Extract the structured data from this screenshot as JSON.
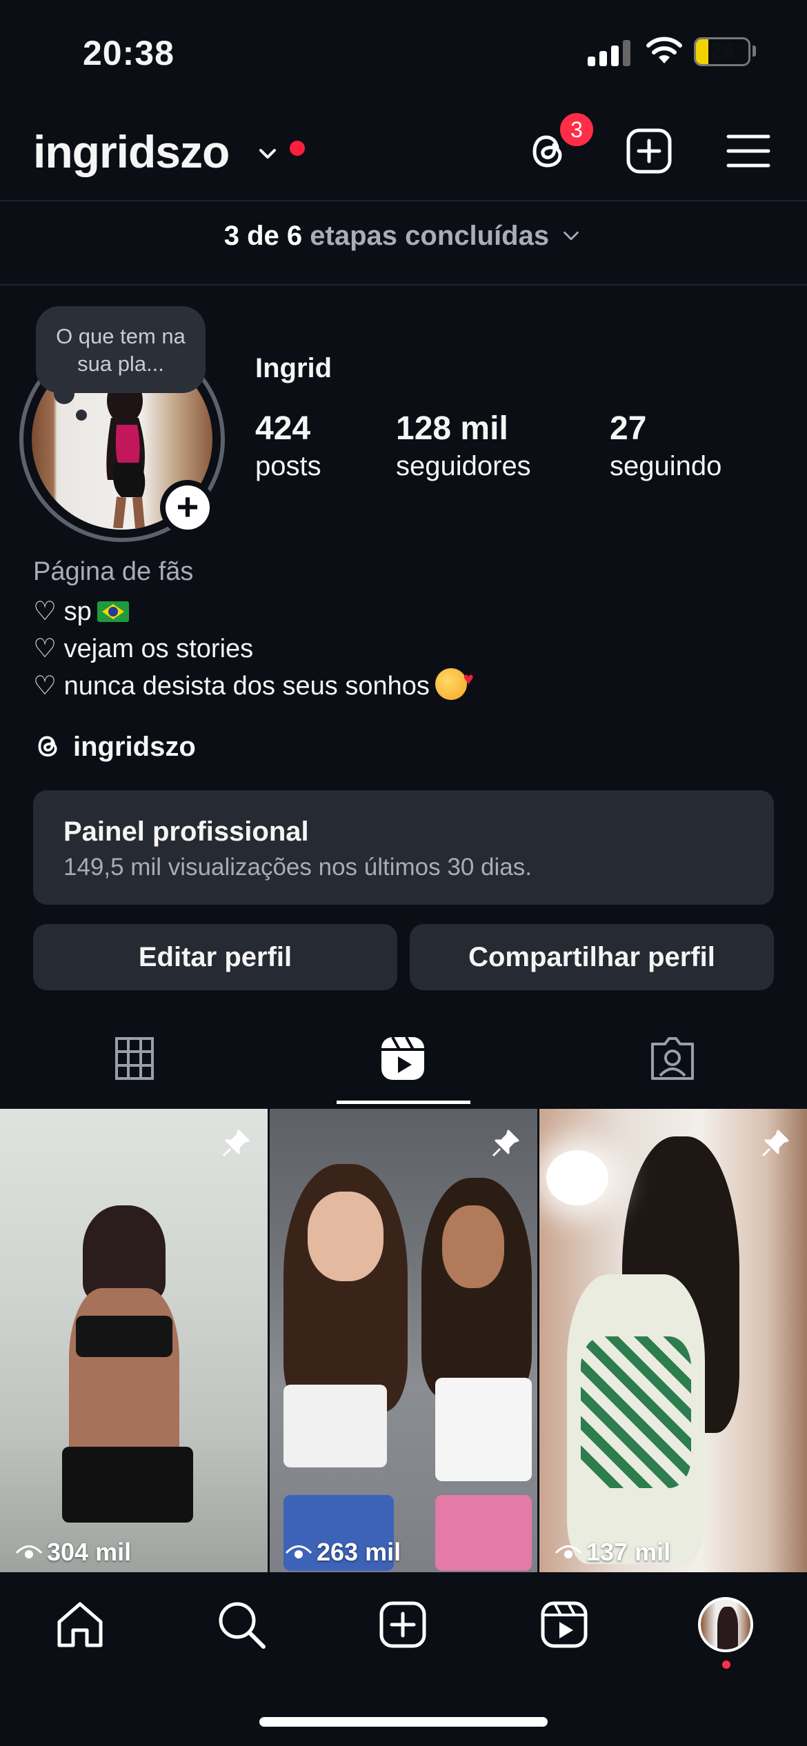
{
  "status_bar": {
    "time": "20:38",
    "battery": "24",
    "battery_level": 0.24
  },
  "header": {
    "username": "ingridszo",
    "threads_badge": "3",
    "icons": [
      "chevron-down-icon",
      "threads-icon",
      "create-icon",
      "menu-icon"
    ]
  },
  "steps": {
    "count": "3 de 6",
    "label": "etapas concluídas"
  },
  "profile": {
    "note": "O que tem na sua pla...",
    "name": "Ingrid",
    "stats": [
      {
        "value": "424",
        "label": "posts"
      },
      {
        "value": "128 mil",
        "label": "seguidores"
      },
      {
        "value": "27",
        "label": "seguindo"
      }
    ],
    "category": "Página de fãs",
    "bio": [
      "♡ sp",
      "♡ vejam os stories",
      "♡ nunca desista dos seus sonhos"
    ],
    "threads_handle": "ingridszo"
  },
  "dashboard": {
    "title": "Painel profissional",
    "subtitle": "149,5 mil visualizações nos últimos 30 dias."
  },
  "buttons": {
    "edit": "Editar perfil",
    "share": "Compartilhar perfil"
  },
  "tabs": {
    "active": "reels",
    "items": [
      "grid-icon",
      "reels-icon",
      "tagged-icon"
    ]
  },
  "reels": [
    {
      "views": "304 mil",
      "pinned": true
    },
    {
      "views": "263 mil",
      "pinned": true
    },
    {
      "views": "137 mil",
      "pinned": true
    }
  ],
  "nav": {
    "items": [
      "home-icon",
      "search-icon",
      "create-icon",
      "reels-icon",
      "profile-avatar"
    ]
  },
  "colors": {
    "background": "#0b0e14",
    "card": "#262a32",
    "notification": "#ff2d45",
    "muted_text": "#a8adb6"
  }
}
